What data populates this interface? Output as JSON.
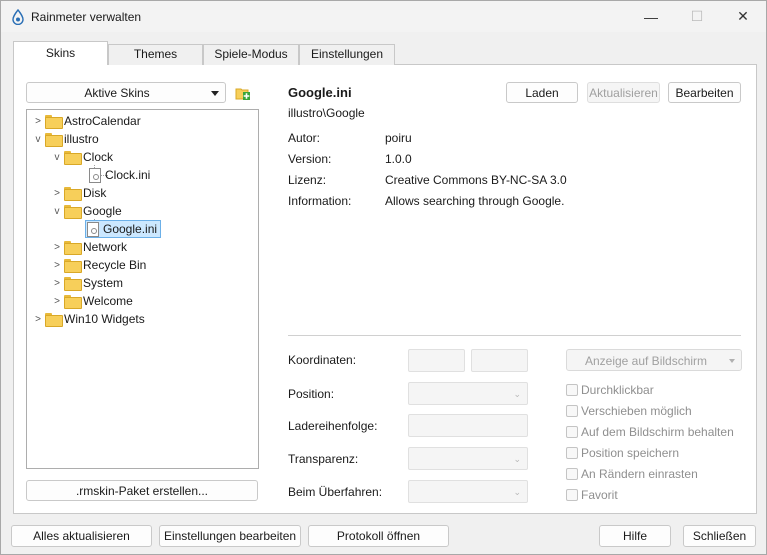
{
  "window": {
    "title": "Rainmeter verwalten",
    "controls": {
      "minimize": "—",
      "maximize": "☐",
      "close": "✕"
    }
  },
  "tabs": [
    {
      "label": "Skins",
      "active": true
    },
    {
      "label": "Themes",
      "active": false
    },
    {
      "label": "Spiele-Modus",
      "active": false
    },
    {
      "label": "Einstellungen",
      "active": false
    }
  ],
  "skins_panel": {
    "active_skins_dropdown": "Aktive Skins",
    "add_icon": "add-folder-icon",
    "tree": [
      {
        "label": "AstroCalendar",
        "type": "folder",
        "expanded": false,
        "level": 0
      },
      {
        "label": "illustro",
        "type": "folder",
        "expanded": true,
        "level": 0
      },
      {
        "label": "Clock",
        "type": "folder",
        "expanded": true,
        "level": 1
      },
      {
        "label": "Clock.ini",
        "type": "file",
        "level": 2
      },
      {
        "label": "Disk",
        "type": "folder",
        "expanded": false,
        "level": 1
      },
      {
        "label": "Google",
        "type": "folder",
        "expanded": true,
        "level": 1
      },
      {
        "label": "Google.ini",
        "type": "file",
        "level": 2,
        "selected": true
      },
      {
        "label": "Network",
        "type": "folder",
        "expanded": false,
        "level": 1
      },
      {
        "label": "Recycle Bin",
        "type": "folder",
        "expanded": false,
        "level": 1
      },
      {
        "label": "System",
        "type": "folder",
        "expanded": false,
        "level": 1
      },
      {
        "label": "Welcome",
        "type": "folder",
        "expanded": false,
        "level": 1
      },
      {
        "label": "Win10 Widgets",
        "type": "folder",
        "expanded": false,
        "level": 0
      }
    ],
    "create_package_button": ".rmskin-Paket erstellen..."
  },
  "details": {
    "skin_name": "Google.ini",
    "skin_path": "illustro\\Google",
    "buttons": {
      "load": "Laden",
      "refresh": "Aktualisieren",
      "edit": "Bearbeiten"
    },
    "meta": [
      {
        "label": "Autor:",
        "value": "poiru"
      },
      {
        "label": "Version:",
        "value": "1.0.0"
      },
      {
        "label": "Lizenz:",
        "value": "Creative Commons BY-NC-SA 3.0"
      },
      {
        "label": "Information:",
        "value": "Allows searching through Google."
      }
    ],
    "form": {
      "coordinates": "Koordinaten:",
      "position": "Position:",
      "load_order": "Ladereihenfolge:",
      "transparency": "Transparenz:",
      "on_hover": "Beim Überfahren:",
      "display_dropdown": "Anzeige auf Bildschirm"
    },
    "checkboxes": [
      "Durchklickbar",
      "Verschieben möglich",
      "Auf dem Bildschirm behalten",
      "Position speichern",
      "An Rändern einrasten",
      "Favorit"
    ]
  },
  "footer": {
    "refresh_all": "Alles aktualisieren",
    "edit_settings": "Einstellungen bearbeiten",
    "open_log": "Protokoll öffnen",
    "help": "Hilfe",
    "close": "Schließen"
  }
}
